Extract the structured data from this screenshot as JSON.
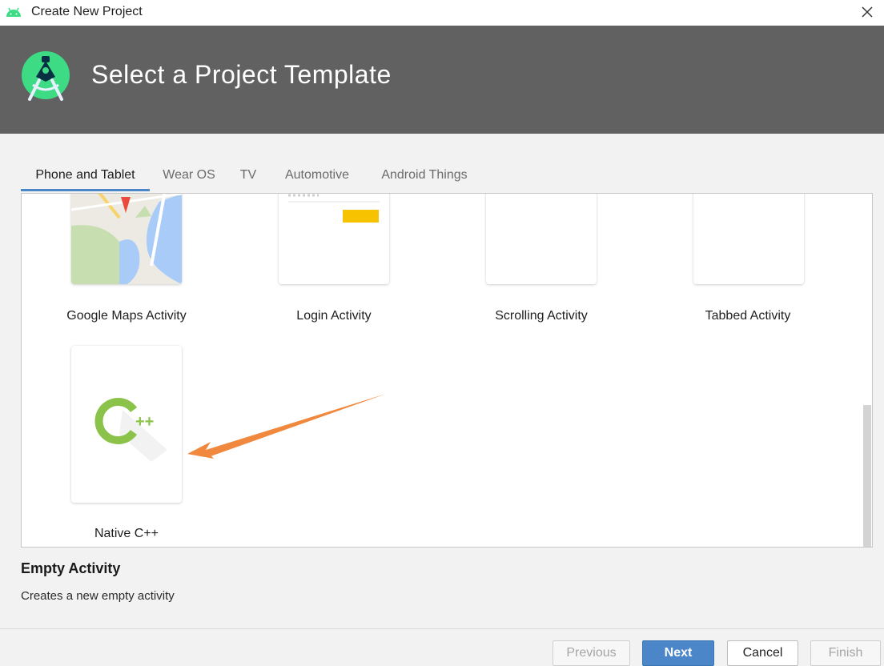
{
  "window": {
    "title": "Create New Project"
  },
  "header": {
    "heading": "Select a Project Template"
  },
  "tabs": [
    {
      "label": "Phone and Tablet",
      "active": true
    },
    {
      "label": "Wear OS",
      "active": false
    },
    {
      "label": "TV",
      "active": false
    },
    {
      "label": "Automotive",
      "active": false
    },
    {
      "label": "Android Things",
      "active": false
    }
  ],
  "templates": [
    {
      "label": "Google Maps Activity",
      "icon": "google-maps-preview"
    },
    {
      "label": "Login Activity",
      "icon": "login-preview"
    },
    {
      "label": "Scrolling Activity",
      "icon": "scrolling-preview"
    },
    {
      "label": "Tabbed Activity",
      "icon": "tabbed-preview"
    },
    {
      "label": "Native C++",
      "icon": "cpp-icon"
    }
  ],
  "selected_template": {
    "title": "Empty Activity",
    "description": "Creates a new empty activity"
  },
  "buttons": {
    "previous": "Previous",
    "next": "Next",
    "cancel": "Cancel",
    "finish": "Finish"
  },
  "colors": {
    "header_bg": "#616161",
    "accent": "#4a86c8",
    "android_green": "#3ddc84",
    "cpp_green": "#8bc34a",
    "annotation_arrow": "#f0883e"
  }
}
